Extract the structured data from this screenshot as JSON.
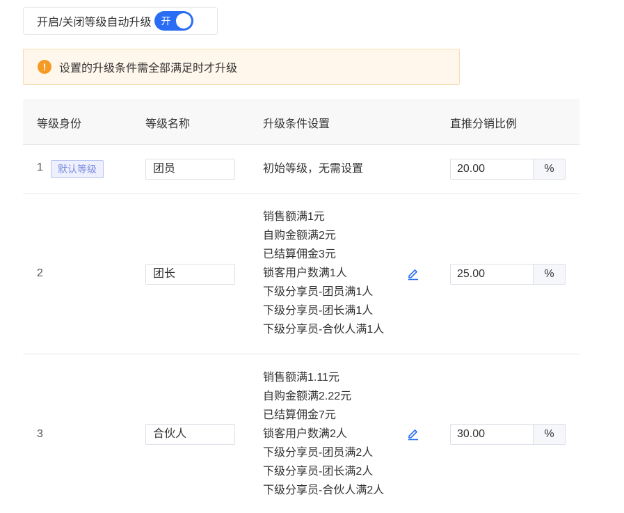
{
  "toggle": {
    "label": "开启/关闭等级自动升级",
    "switch_text": "开",
    "enabled": true
  },
  "alert": {
    "icon": "warning-icon",
    "text": "设置的升级条件需全部满足时才升级"
  },
  "table": {
    "headers": {
      "level": "等级身份",
      "name": "等级名称",
      "conditions": "升级条件设置",
      "ratio": "直推分销比例"
    },
    "rows": [
      {
        "level": "1",
        "tag": "默认等级",
        "name": "团员",
        "conditions": [
          "初始等级，无需设置"
        ],
        "ratio": "20.00",
        "unit": "%"
      },
      {
        "level": "2",
        "name": "团长",
        "conditions": [
          "销售额满1元",
          "自购金额满2元",
          "已结算佣金3元",
          "锁客用户数满1人",
          "下级分享员-团员满1人",
          "下级分享员-团长满1人",
          "下级分享员-合伙人满1人"
        ],
        "ratio": "25.00",
        "unit": "%"
      },
      {
        "level": "3",
        "name": "合伙人",
        "conditions": [
          "销售额满1.11元",
          "自购金额满2.22元",
          "已结算佣金7元",
          "锁客用户数满2人",
          "下级分享员-团员满2人",
          "下级分享员-团长满2人",
          "下级分享员-合伙人满2人"
        ],
        "ratio": "30.00",
        "unit": "%"
      }
    ]
  },
  "colors": {
    "accent": "#2a6df4",
    "warning": "#f59a23",
    "alert_bg": "#fff7ec"
  }
}
